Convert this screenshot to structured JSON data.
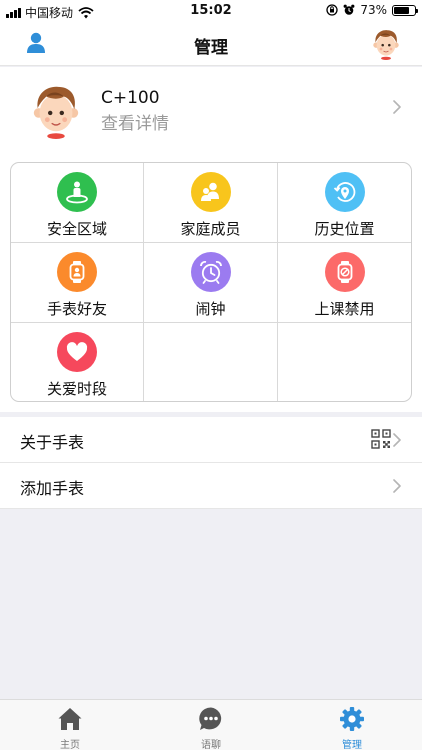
{
  "status_bar": {
    "carrier": "中国移动",
    "time": "15:02",
    "battery": "73%",
    "battery_level": 0.73
  },
  "header": {
    "title": "管理"
  },
  "profile": {
    "name": "C+100",
    "detail": "查看详情"
  },
  "grid": [
    {
      "label": "安全区域",
      "icon": "safe-zone-icon",
      "color": "#2fbf4f"
    },
    {
      "label": "家庭成员",
      "icon": "family-icon",
      "color": "#f8c51c"
    },
    {
      "label": "历史位置",
      "icon": "location-history-icon",
      "color": "#4fc0f5"
    },
    {
      "label": "手表好友",
      "icon": "watch-friend-icon",
      "color": "#fb8a2c"
    },
    {
      "label": "闹钟",
      "icon": "alarm-clock-icon",
      "color": "#9b7bf0"
    },
    {
      "label": "上课禁用",
      "icon": "class-ban-icon",
      "color": "#fc6a69"
    },
    {
      "label": "关爱时段",
      "icon": "heart-icon",
      "color": "#f6485c"
    }
  ],
  "list": {
    "about": "关于手表",
    "add": "添加手表"
  },
  "tabs": [
    {
      "label": "主页",
      "icon": "home-icon"
    },
    {
      "label": "语聊",
      "icon": "chat-icon"
    },
    {
      "label": "管理",
      "icon": "settings-gear-icon",
      "active": true
    }
  ],
  "colors": {
    "accent": "#2f8ed8",
    "tab_inactive": "#555555"
  }
}
